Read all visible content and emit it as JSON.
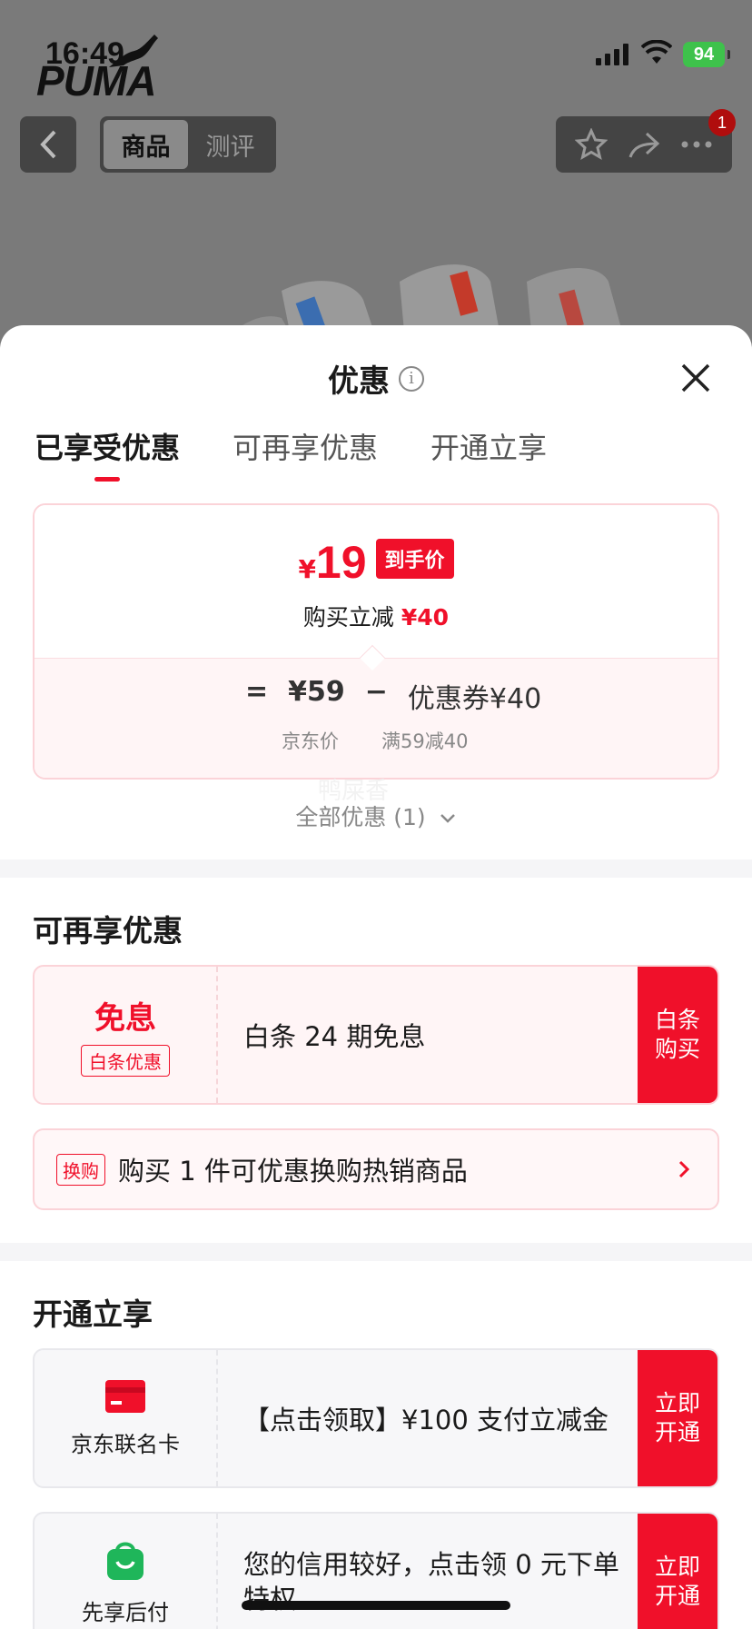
{
  "status_bar": {
    "time": "16:49",
    "battery": "94"
  },
  "background_page": {
    "logo": "PUMA",
    "tabs": [
      {
        "label": "商品"
      },
      {
        "label": "测评"
      }
    ],
    "notification_count": "1"
  },
  "sheet": {
    "title": "优惠",
    "tabs": [
      {
        "label": "已享受优惠",
        "active": true
      },
      {
        "label": "可再享优惠",
        "active": false
      },
      {
        "label": "开通立享",
        "active": false
      }
    ],
    "price_card": {
      "currency": "¥",
      "final_price": "19",
      "final_price_tag": "到手价",
      "reduce_text": "购买立减",
      "reduce_amount": "¥40",
      "equals": "=",
      "jd_price": "¥59",
      "minus": "−",
      "coupon": "优惠券¥40",
      "jd_price_label": "京东价",
      "coupon_desc": "满59减40"
    },
    "watermark": "鸭屎香",
    "all_offers": "全部优惠 (1)"
  },
  "reenjoy": {
    "title": "可再享优惠",
    "baitiao": {
      "badge_title": "免息",
      "badge_sub": "白条优惠",
      "text": "白条 24 期免息",
      "action": "白条购买"
    },
    "swap": {
      "badge": "换购",
      "text": "购买 1 件可优惠换购热销商品"
    }
  },
  "open_enjoy": {
    "title": "开通立享",
    "items": [
      {
        "label": "京东联名卡",
        "text": "【点击领取】¥100 支付立减金",
        "action": "立即开通",
        "icon": "card-icon"
      },
      {
        "label": "先享后付",
        "text": "您的信用较好，点击领 0 元下单特权",
        "action": "立即开通",
        "icon": "shopping-bag-icon"
      }
    ]
  },
  "colors": {
    "accent": "#f0102a",
    "accent_light": "#fff5f6",
    "border_pink": "#fbd3d8"
  }
}
